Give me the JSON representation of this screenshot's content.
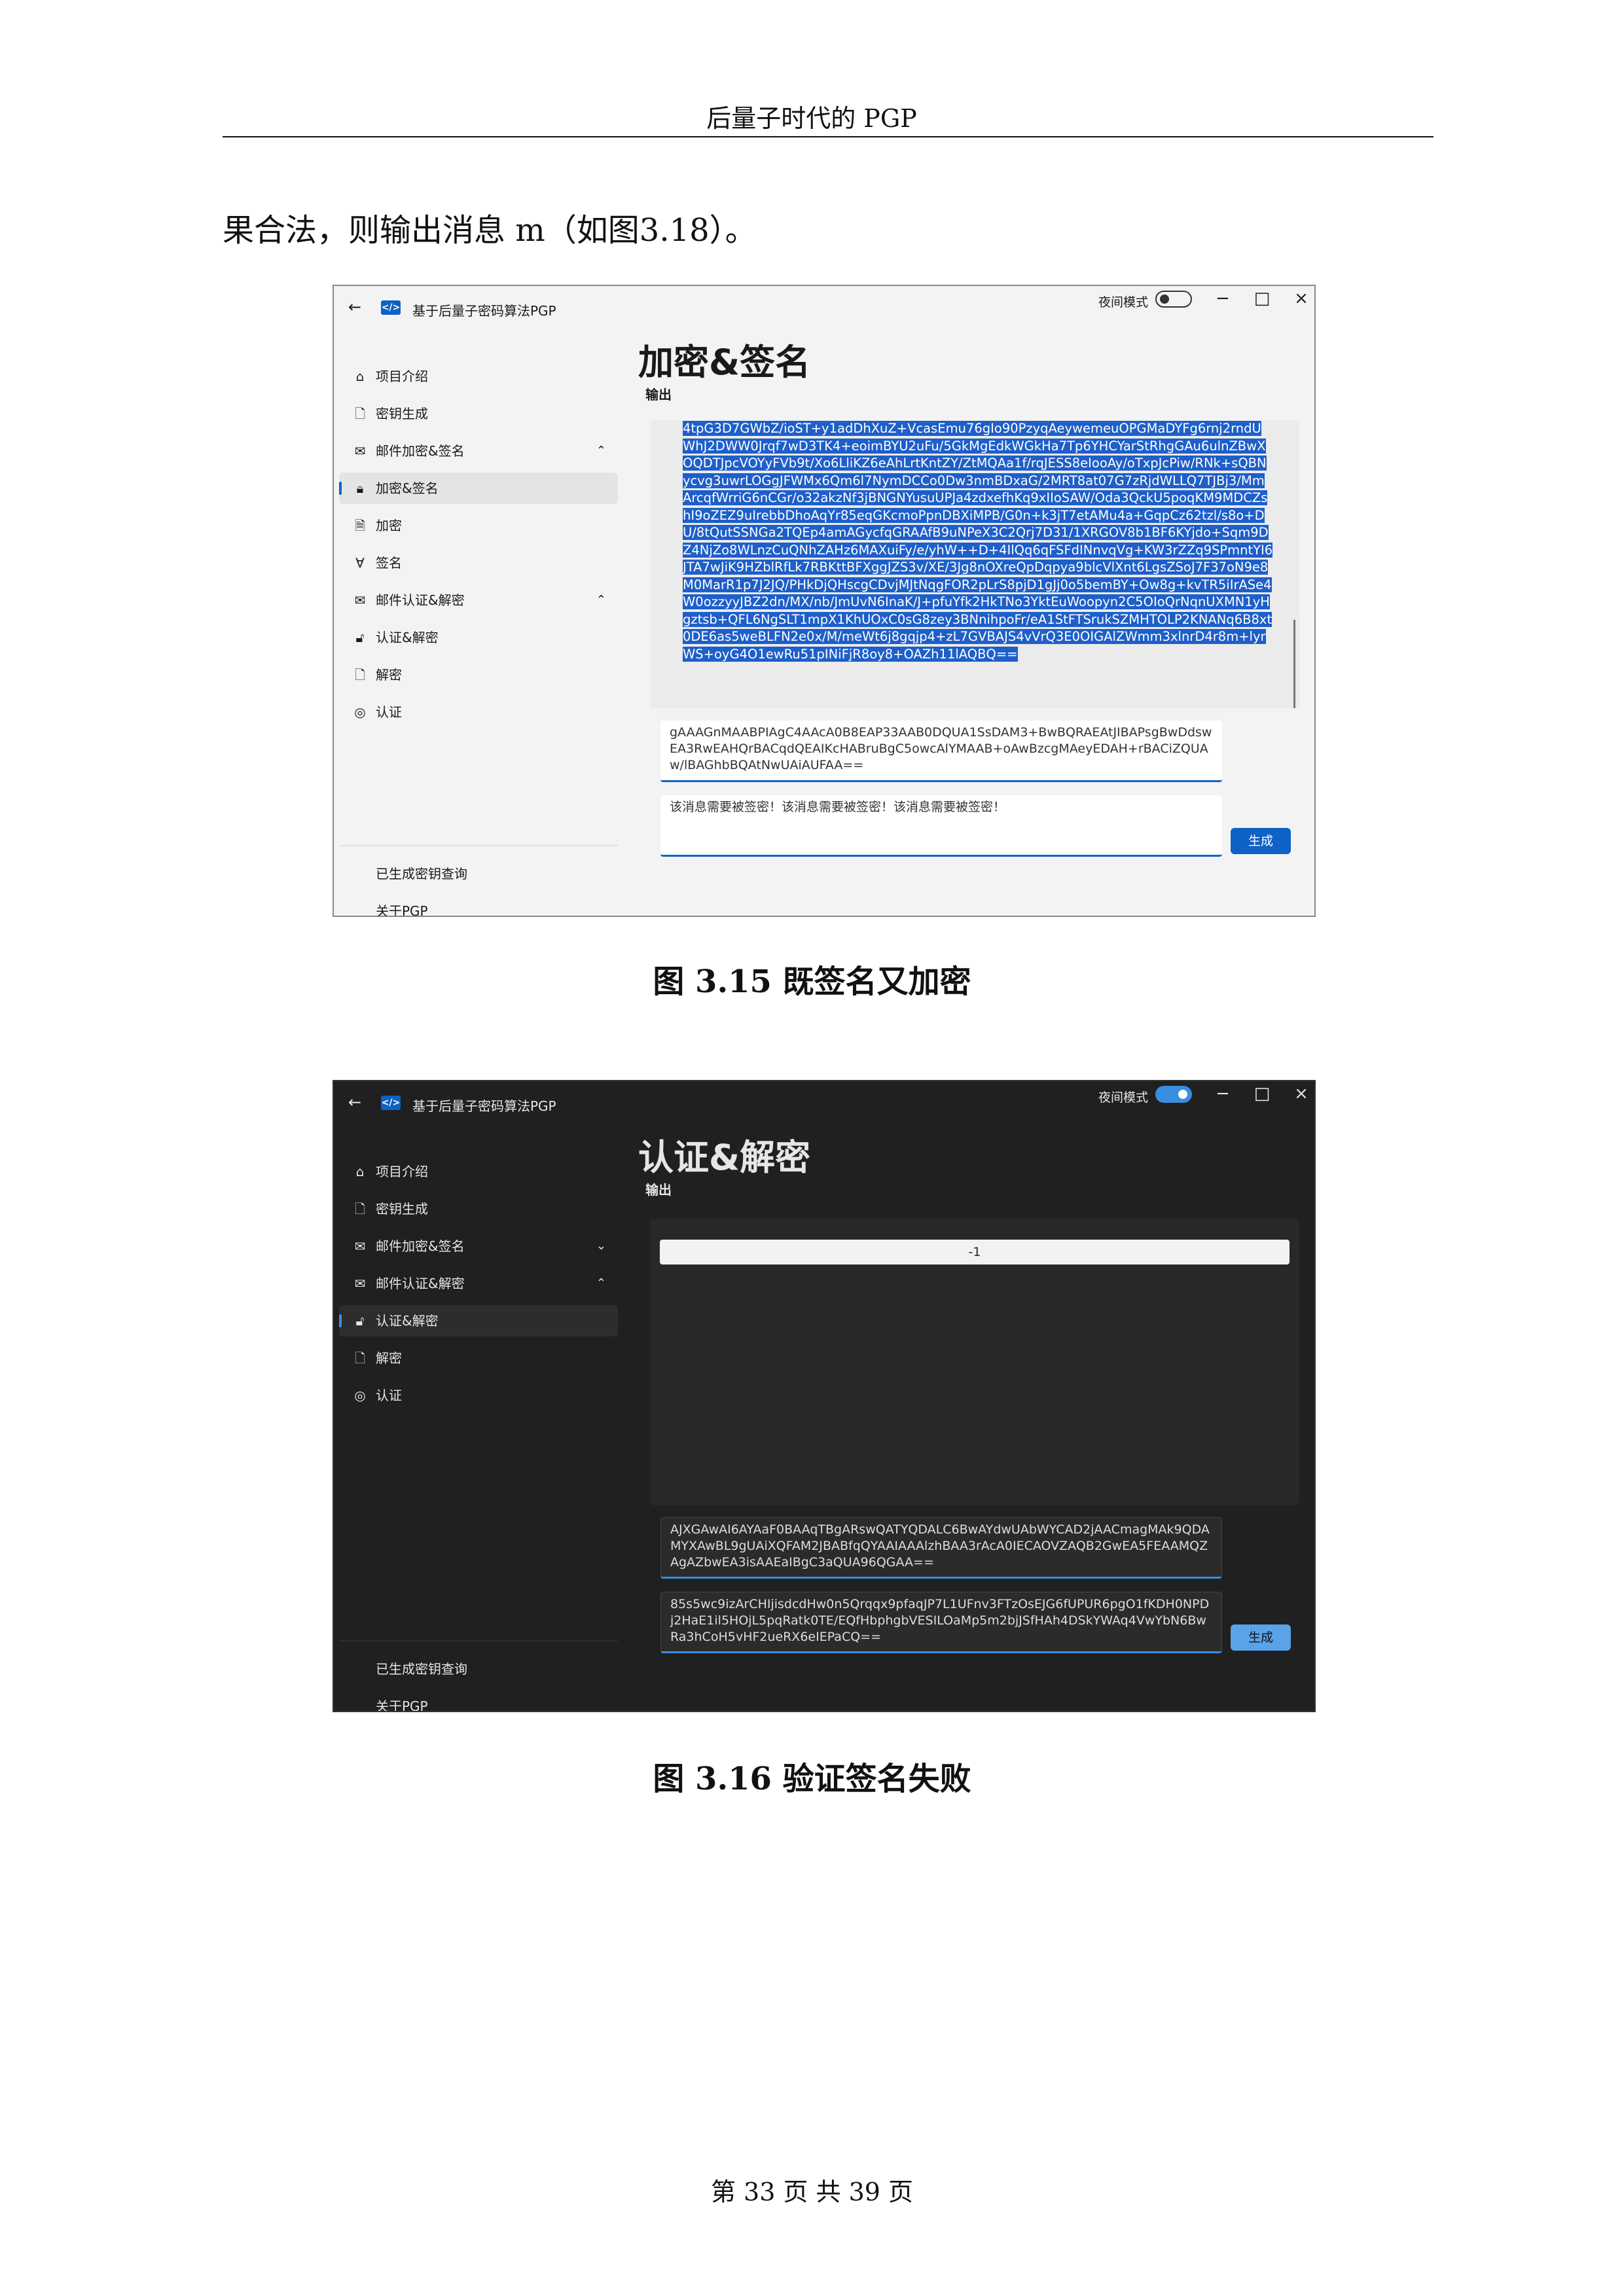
{
  "page": {
    "header": "后量子时代的 PGP",
    "body_line": "果合法，则输出消息 m（如图3.18）。",
    "footer": "第 33 页   共 39 页"
  },
  "figures": [
    {
      "caption": "图 3.15   既签名又加密",
      "theme": "light",
      "app_title": "基于后量子密码算法PGP",
      "night_mode_label": "夜间模式",
      "night_mode_on": false,
      "nav": [
        {
          "label": "项目介绍",
          "icon": "home-icon"
        },
        {
          "label": "密钥生成",
          "icon": "key-file-icon"
        },
        {
          "label": "邮件加密&签名",
          "icon": "mail-lock-icon",
          "chevron": "^"
        },
        {
          "label": "加密&签名",
          "icon": "lock-pen-icon",
          "selected": true
        },
        {
          "label": "加密",
          "icon": "lock-doc-icon"
        },
        {
          "label": "签名",
          "icon": "signature-icon"
        },
        {
          "label": "邮件认证&解密",
          "icon": "mail-unlock-icon",
          "chevron": "^"
        },
        {
          "label": "认证&解密",
          "icon": "unlock-check-icon"
        },
        {
          "label": "解密",
          "icon": "doc-icon"
        },
        {
          "label": "认证",
          "icon": "fingerprint-icon"
        }
      ],
      "nav_bottom": [
        "已生成密钥查询",
        "关于PGP"
      ],
      "page_title": "加密&签名",
      "output_label": "输出",
      "output_text": "4tpG3D7GWbZ/ioST+y1adDhXuZ+VcasEmu76gIo90PzyqAeywemeuOPGMaDYFg6rnj2rndUWhJ2DWW0Jrqf7wD3TK4+eoimBYU2uFu/5GkMgEdkWGkHa7Tp6YHCYarStRhgGAu6ulnZBwXOQDTJpcVOYyFVb9t/Xo6LliKZ6eAhLrtKntZY/ZtMQAa1f/rqJESS8eIooAy/oTxpJcPiw/RNk+sQBNycvg3uwrLOGgJFWMx6Qm6l7NymDCCo0Dw3nmBDxaG/2MRT8at07G7zRjdWLLQ7TJBj3/MmArcqfWrriG6nCGr/o32akzNf3jBNGNYusuUPJa4zdxefhKq9xIIoSAW/Oda3QckU5poqKM9MDCZshI9oZEZ9uIrebbDhoAqYr85eqGKcmoPpnDBXiMPB/G0n+k3jT7etAMu4a+GqpCz62tzl/s8o+DU/8tQutSSNGa2TQEp4amAGycfqGRAAfB9uNPeX3C2Qrj7D31/1XRGOV8b1BF6KYjdo+Sqm9DZ4NjZo8WLnzCuQNhZAHz6MAXuiFy/e/yhW++D+4IlQq6qFSFdINnvqVg+KW3rZZq9SPmntYI6JTA7wJiK9HZblRfLk7RBKttBFXggJZS3v/XE/3Jg8nOXreQpDqpya9blcVlXnt6LgsZSoJ7F37oN9e8M0MarR1p7J2JQ/PHkDjQHscgCDvjMJtNqgFOR2pLrS8pjD1gJj0o5bemBY+Ow8g+kvTR5iIrASe4W0ozzyyJBZ2dn/MX/nb/JmUvN6InaK/J+pfuYfk2HkTNo3YktEuWoopyn2C5OIoQrNqnUXMN1yHgztsb+QFL6NgSLT1mpX1KhUOxC0sG8zey3BNnihpoFr/eA1StFTSrukSZMHTOLP2KNANq6B8xt0DE6as5weBLFN2e0x/M/meWt6j8gqjp4+zL7GVBAJS4vVrQ3E0OIGAlZWmm3xlnrD4r8m+lyrWS+oyG4O1ewRu51pINiFjR8oy8+OAZh11lAQBQ==",
      "field1": "gAAAGnMAABPIAgC4AAcA0B8EAP33AAB0DQUA1SsDAM3+BwBQRAEAtJIBAPsgBwDdswEA3RwEAHQrBACqdQEAIKcHABruBgC5owcAlYMAAB+oAwBzcgMAeyEDAH+rBACiZQUAw/lBAGhbBQAtNwUAiAUFAA==",
      "field2": "该消息需要被签密！该消息需要被签密！该消息需要被签密！",
      "button": "生成"
    },
    {
      "caption": "图 3.16   验证签名失败",
      "theme": "dark",
      "app_title": "基于后量子密码算法PGP",
      "night_mode_label": "夜间模式",
      "night_mode_on": true,
      "nav": [
        {
          "label": "项目介绍",
          "icon": "home-icon"
        },
        {
          "label": "密钥生成",
          "icon": "key-file-icon"
        },
        {
          "label": "邮件加密&签名",
          "icon": "mail-lock-icon",
          "chevron": "v"
        },
        {
          "label": "邮件认证&解密",
          "icon": "mail-unlock-icon",
          "chevron": "^"
        },
        {
          "label": "认证&解密",
          "icon": "unlock-check-icon",
          "selected": true
        },
        {
          "label": "解密",
          "icon": "doc-icon"
        },
        {
          "label": "认证",
          "icon": "fingerprint-icon"
        }
      ],
      "nav_bottom": [
        "已生成密钥查询",
        "关于PGP"
      ],
      "page_title": "认证&解密",
      "output_label": "输出",
      "result": "-1",
      "field1": "AJXGAwAI6AYAaF0BAAqTBgARswQATYQDALC6BwAYdwUAbWYCAD2jAACmagMAk9QDAMYXAwBL9gUAiXQFAM2JBABfqQYAAIAAAlzhBAA3rAcA0IECAOVZAQB2GwEA5FEAAMQZAgAZbwEA3isAAEaIBgC3aQUA96QGAA==",
      "field2": "85s5wc9izArCHIjisdcdHw0n5Qrqqx9pfaqJP7L1UFnv3FTzOsEJG6fUPUR6pgO1fKDH0NPDj2HaE1il5HOjL5pqRatk0TE/EQfHbphgbVESILOaMp5m2bjJSfHAh4DSkYWAq4VwYbN6BwRa3hCoH5vHF2ueRX6eIEPaCQ==",
      "button": "生成"
    }
  ]
}
